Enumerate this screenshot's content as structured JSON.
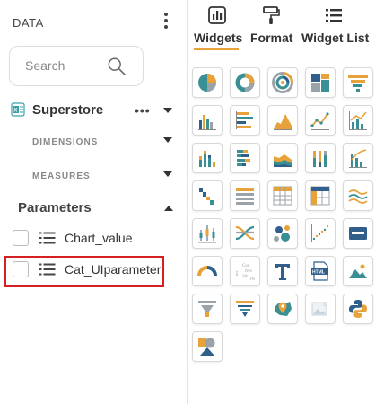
{
  "data_panel": {
    "title": "DATA",
    "search": {
      "placeholder": "Search",
      "value": ""
    },
    "datasource": {
      "name": "Superstore",
      "more": "•••"
    },
    "sections": {
      "dimensions": "DIMENSIONS",
      "measures": "MEASURES"
    },
    "parameters": {
      "title": "Parameters",
      "items": [
        {
          "label": "Chart_value"
        },
        {
          "label": "Cat_UIparameter"
        }
      ]
    }
  },
  "widget_panel": {
    "tabs": [
      {
        "label": "Widgets",
        "icon": "widgets-chart-icon",
        "active": true
      },
      {
        "label": "Format",
        "icon": "paint-roller-icon",
        "active": false
      },
      {
        "label": "Widget List",
        "icon": "list-icon",
        "active": false
      }
    ],
    "widgets": [
      {
        "name": "pie-chart"
      },
      {
        "name": "donut-chart"
      },
      {
        "name": "sunburst-chart"
      },
      {
        "name": "treemap-chart"
      },
      {
        "name": "funnel-chart"
      },
      {
        "name": "column-chart"
      },
      {
        "name": "bar-chart"
      },
      {
        "name": "area-chart"
      },
      {
        "name": "line-chart"
      },
      {
        "name": "combo-chart"
      },
      {
        "name": "stacked-column-chart"
      },
      {
        "name": "stacked-bar-chart"
      },
      {
        "name": "stacked-area-chart"
      },
      {
        "name": "percent-column-chart"
      },
      {
        "name": "pareto-chart"
      },
      {
        "name": "waterfall-chart"
      },
      {
        "name": "table-grid"
      },
      {
        "name": "pivot-table"
      },
      {
        "name": "cross-tab"
      },
      {
        "name": "multi-line-chart"
      },
      {
        "name": "box-plot"
      },
      {
        "name": "sankey-chart"
      },
      {
        "name": "bubble-chart"
      },
      {
        "name": "scatter-chart"
      },
      {
        "name": "kpi-card"
      },
      {
        "name": "gauge-chart"
      },
      {
        "name": "word-cloud"
      },
      {
        "name": "text-widget"
      },
      {
        "name": "html-widget"
      },
      {
        "name": "image-widget"
      },
      {
        "name": "filter-funnel"
      },
      {
        "name": "slicer-filter"
      },
      {
        "name": "map-chart"
      },
      {
        "name": "image-gallery"
      },
      {
        "name": "python-widget"
      },
      {
        "name": "shapes-widget"
      }
    ],
    "word_cloud_text": [
      "Con",
      "fere",
      "Stk",
      "nce",
      "DS"
    ],
    "html_label": "HTML"
  },
  "colors": {
    "orange": "#e8a23a",
    "teal": "#3a8f94",
    "blue": "#2f5f8a",
    "gray": "#9aa3aa",
    "highlight": "#d42020"
  }
}
